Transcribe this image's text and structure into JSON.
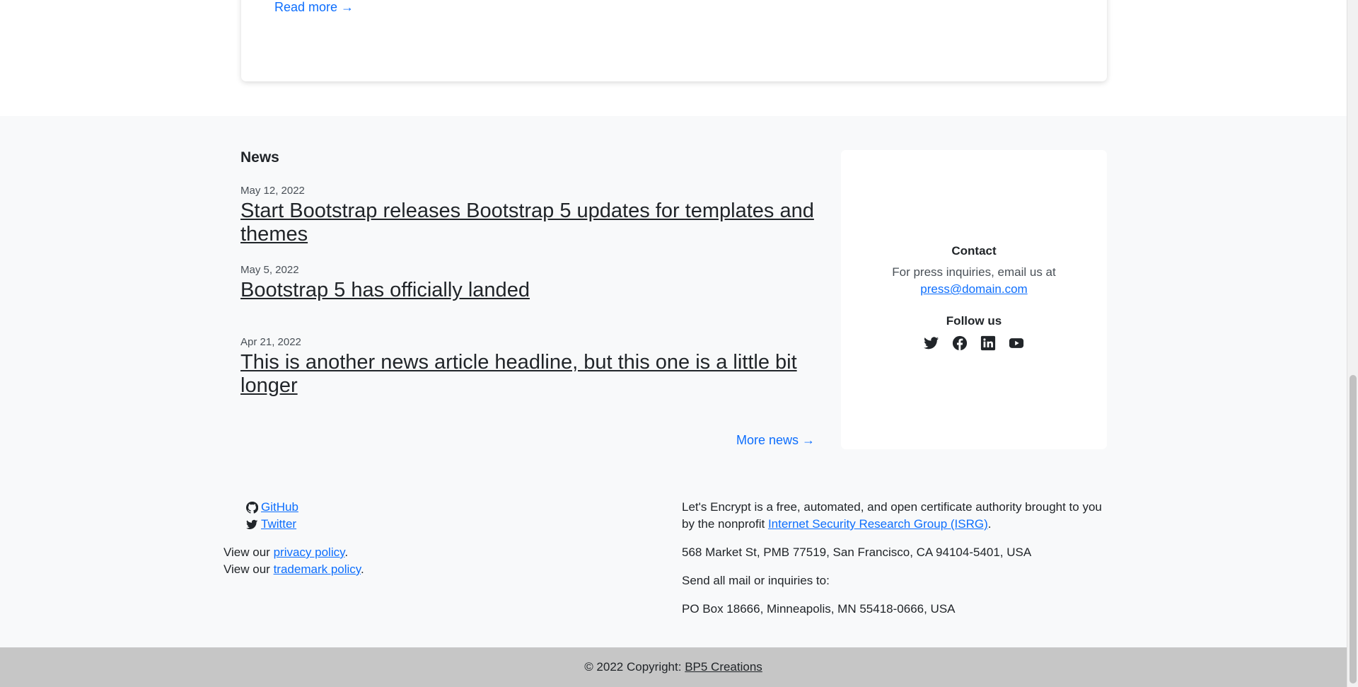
{
  "top_card": {
    "read_more": "Read more →"
  },
  "news": {
    "title": "News",
    "items": [
      {
        "date": "May 12, 2022",
        "headline": "Start Bootstrap releases Bootstrap 5 updates for templates and themes"
      },
      {
        "date": "May 5, 2022",
        "headline": "Bootstrap 5 has officially landed"
      },
      {
        "date": "Apr 21, 2022",
        "headline": "This is another news article headline, but this one is a little bit longer"
      }
    ],
    "more": "More news →"
  },
  "contact": {
    "title": "Contact",
    "text": "For press inquiries, email us at",
    "email": "press@domain.com",
    "follow_title": "Follow us",
    "social_icons": [
      "twitter-icon",
      "facebook-icon",
      "linkedin-icon",
      "youtube-icon"
    ]
  },
  "footer": {
    "github": "GitHub",
    "twitter": "Twitter",
    "view_our_1": "View our",
    "privacy_policy": "privacy policy",
    "period": ".",
    "view_our_2": "View our",
    "trademark_policy": "trademark policy",
    "le_text": "Let's Encrypt is a free, automated, and open certificate authority brought to you by the nonprofit",
    "isrg_link": "Internet Security Research Group (ISRG)",
    "address": "568 Market St, PMB 77519, San Francisco, CA 94104-5401, USA",
    "mail_label": "Send all mail or inquiries to:",
    "po_box": "PO Box 18666, Minneapolis, MN 55418-0666, USA"
  },
  "copyright": {
    "text": "© 2022 Copyright: ",
    "link": "BP5 Creations"
  },
  "colors": {
    "accent": "#0d6efd",
    "footer_bar": "#c6c6c6",
    "section_bg": "#f8f9fa"
  }
}
